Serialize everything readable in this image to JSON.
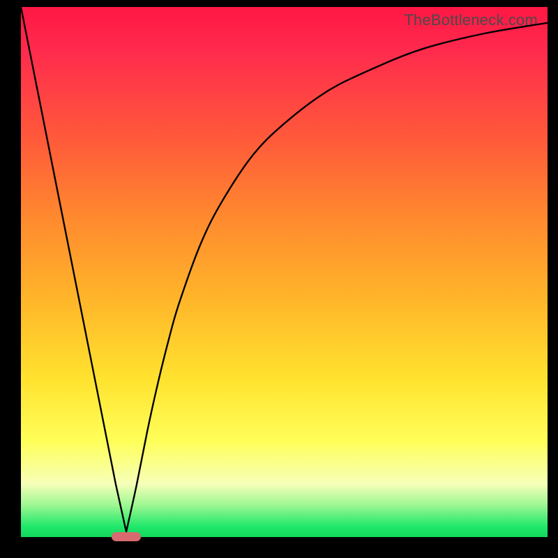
{
  "watermark": "TheBottleneck.com",
  "colors": {
    "background_black": "#000000",
    "grad_top": "#ff1744",
    "grad_mid1": "#ff8a2e",
    "grad_mid2": "#ffe22e",
    "grad_bottom": "#12d85c",
    "curve": "#000000",
    "marker": "#d96a6f"
  },
  "chart_data": {
    "type": "line",
    "title": "",
    "xlabel": "",
    "ylabel": "",
    "xlim": [
      0,
      100
    ],
    "ylim": [
      0,
      100
    ],
    "grid": false,
    "legend": false,
    "notes": "V-shaped bottleneck curve. Left branch descends linearly from top-left to a minimum near x≈20. Right branch rises with decreasing slope (saturating) toward top-right. Minimum marked by rounded pill near x≈20, y≈0.",
    "series": [
      {
        "name": "bottleneck-curve",
        "x": [
          0,
          4,
          8,
          12,
          16,
          18,
          20,
          22,
          24,
          26,
          28,
          30,
          34,
          38,
          44,
          50,
          58,
          66,
          76,
          88,
          100
        ],
        "y": [
          100,
          80,
          60,
          40,
          20,
          10,
          1,
          10,
          20,
          29,
          37,
          44,
          55,
          63,
          72,
          78,
          84,
          88,
          92,
          95,
          97
        ]
      }
    ],
    "marker": {
      "x": 20,
      "y": 0,
      "shape": "pill"
    }
  }
}
